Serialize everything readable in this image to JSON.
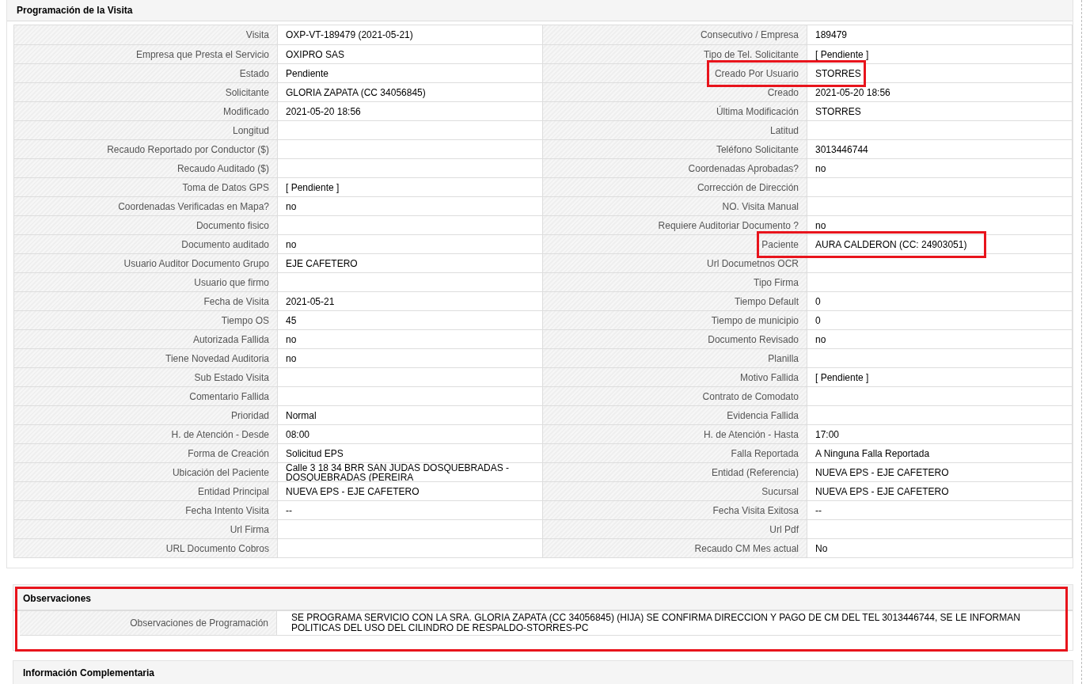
{
  "visit_section": {
    "title": "Programación de la Visita",
    "rows": [
      {
        "left": {
          "label": "Visita",
          "value": "OXP-VT-189479 (2021-05-21)"
        },
        "right": {
          "label": "Consecutivo / Empresa",
          "value": "189479"
        }
      },
      {
        "left": {
          "label": "Empresa que Presta el Servicio",
          "value": "OXIPRO SAS"
        },
        "right": {
          "label": "Tipo de Tel. Solicitante",
          "value": "[ Pendiente ]"
        }
      },
      {
        "left": {
          "label": "Estado",
          "value": "Pendiente"
        },
        "right": {
          "label": "Creado Por Usuario",
          "value": "STORRES",
          "highlighted": true
        }
      },
      {
        "left": {
          "label": "Solicitante",
          "value": "GLORIA ZAPATA (CC 34056845)"
        },
        "right": {
          "label": "Creado",
          "value": "2021-05-20 18:56"
        }
      },
      {
        "left": {
          "label": "Modificado",
          "value": "2021-05-20 18:56"
        },
        "right": {
          "label": "Última Modificación",
          "value": "STORRES"
        }
      },
      {
        "left": {
          "label": "Longitud"
        },
        "right": {
          "label": "Latitud"
        }
      },
      {
        "left": {
          "label": "Recaudo Reportado por Conductor ($)"
        },
        "right": {
          "label": "Teléfono Solicitante",
          "value": "3013446744"
        }
      },
      {
        "left": {
          "label": "Recaudo Auditado ($)"
        },
        "right": {
          "label": "Coordenadas Aprobadas?",
          "value": "no"
        }
      },
      {
        "left": {
          "label": "Toma de Datos GPS",
          "value": "[ Pendiente ]"
        },
        "right": {
          "label": "Corrección de Dirección"
        }
      },
      {
        "left": {
          "label": "Coordenadas Verificadas en Mapa?",
          "value": "no"
        },
        "right": {
          "label": "NO. Visita Manual"
        }
      },
      {
        "left": {
          "label": "Documento fisico"
        },
        "right": {
          "label": "Requiere Auditoriar Documento ?",
          "value": "no"
        }
      },
      {
        "left": {
          "label": "Documento auditado",
          "value": "no"
        },
        "right": {
          "label": "Paciente",
          "value": "AURA CALDERON (CC: 24903051)",
          "highlighted": true
        }
      },
      {
        "left": {
          "label": "Usuario Auditor Documento Grupo",
          "value": "EJE CAFETERO"
        },
        "right": {
          "label": "Url Documetnos OCR"
        }
      },
      {
        "left": {
          "label": "Usuario que firmo"
        },
        "right": {
          "label": "Tipo Firma"
        }
      },
      {
        "left": {
          "label": "Fecha de Visita",
          "value": "2021-05-21"
        },
        "right": {
          "label": "Tiempo Default",
          "value": "0"
        }
      },
      {
        "left": {
          "label": "Tiempo OS",
          "value": "45"
        },
        "right": {
          "label": "Tiempo de municipio",
          "value": "0"
        }
      },
      {
        "left": {
          "label": "Autorizada Fallida",
          "value": "no"
        },
        "right": {
          "label": "Documento Revisado",
          "value": "no"
        }
      },
      {
        "left": {
          "label": "Tiene Novedad Auditoria",
          "value": "no"
        },
        "right": {
          "label": "Planilla"
        }
      },
      {
        "left": {
          "label": "Sub Estado Visita"
        },
        "right": {
          "label": "Motivo Fallida",
          "value": "[ Pendiente ]"
        }
      },
      {
        "left": {
          "label": "Comentario Fallida"
        },
        "right": {
          "label": "Contrato de Comodato"
        }
      },
      {
        "left": {
          "label": "Prioridad",
          "value": "Normal"
        },
        "right": {
          "label": "Evidencia Fallida"
        }
      },
      {
        "left": {
          "label": "H. de Atención - Desde",
          "value": "08:00"
        },
        "right": {
          "label": "H. de Atención - Hasta",
          "value": "17:00"
        }
      },
      {
        "left": {
          "label": "Forma de Creación",
          "value": "Solicitud EPS"
        },
        "right": {
          "label": "Falla Reportada",
          "value": "A Ninguna Falla Reportada"
        }
      },
      {
        "left": {
          "label": "Ubicación del Paciente",
          "value": "Calle 3 18 34 BRR SAN JUDAS DOSQUEBRADAS - DOSQUEBRADAS (PEREIRA"
        },
        "right": {
          "label": "Entidad (Referencia)",
          "value": "NUEVA EPS - EJE CAFETERO"
        }
      },
      {
        "left": {
          "label": "Entidad Principal",
          "value": "NUEVA EPS - EJE CAFETERO"
        },
        "right": {
          "label": "Sucursal",
          "value": "NUEVA EPS - EJE CAFETERO"
        }
      },
      {
        "left": {
          "label": "Fecha Intento Visita",
          "value": "--"
        },
        "right": {
          "label": "Fecha Visita Exitosa",
          "value": "--"
        }
      },
      {
        "left": {
          "label": "Url Firma"
        },
        "right": {
          "label": "Url Pdf"
        }
      },
      {
        "left": {
          "label": "URL Documento Cobros"
        },
        "right": {
          "label": "Recaudo CM Mes actual",
          "value": "No"
        }
      }
    ]
  },
  "observations_section": {
    "title": "Observaciones",
    "highlighted": true,
    "rows": [
      {
        "label": "Observaciones de Programación",
        "value": "SE PROGRAMA SERVICIO CON LA SRA. GLORIA ZAPATA (CC 34056845) (HIJA) SE CONFIRMA DIRECCION Y PAGO DE CM DEL TEL 3013446744, SE LE INFORMAN POLITICAS DEL USO DEL CILINDRO DE RESPALDO-STORRES-PC"
      }
    ]
  },
  "complementary_section": {
    "title": "Información Complementaria"
  }
}
